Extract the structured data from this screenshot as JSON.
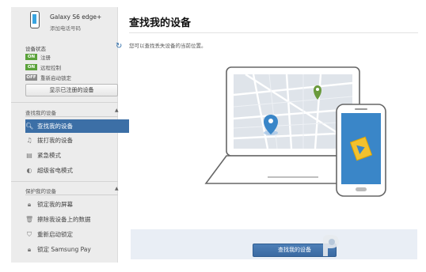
{
  "device": {
    "name": "Galaxy S6 edge+",
    "subtitle": "添加电话号码"
  },
  "status": {
    "title": "设备状态",
    "items": [
      {
        "badge": "ON",
        "label": "注册"
      },
      {
        "badge": "ON",
        "label": "远程控制"
      },
      {
        "badge": "OFF",
        "label": "重新启动锁定"
      }
    ],
    "show_registered_button": "显示已注册的设备"
  },
  "sections": [
    {
      "title": "查找我的设备",
      "items": [
        {
          "label": "查找我的设备",
          "icon": "search-icon",
          "glyph": "🔍︎",
          "active": true
        },
        {
          "label": "拨打我的设备",
          "icon": "music-note-icon",
          "glyph": "♫",
          "active": false
        },
        {
          "label": "紧急模式",
          "icon": "emergency-icon",
          "glyph": "▤",
          "active": false
        },
        {
          "label": "超级省电模式",
          "icon": "power-saving-icon",
          "glyph": "◐",
          "active": false
        }
      ]
    },
    {
      "title": "保护我的设备",
      "items": [
        {
          "label": "锁定我的屏幕",
          "icon": "lock-icon",
          "glyph": "🔒︎",
          "active": false
        },
        {
          "label": "擦除我设备上的数据",
          "icon": "trash-icon",
          "glyph": "🗑︎",
          "active": false
        },
        {
          "label": "重新启动锁定",
          "icon": "shield-icon",
          "glyph": "⛉",
          "active": false
        },
        {
          "label": "锁定 Samsung Pay",
          "icon": "lock-icon",
          "glyph": "🔒︎",
          "active": false
        }
      ]
    }
  ],
  "main": {
    "title": "查找我的设备",
    "description": "您可以查找丢失设备的当前位置。",
    "find_button": "查找我的设备"
  },
  "colors": {
    "accent": "#3c6fa6",
    "on_badge": "#5aa23a",
    "off_badge": "#8a8a8a",
    "pin_blue": "#3a86c8",
    "pin_green": "#6a9a3c"
  }
}
